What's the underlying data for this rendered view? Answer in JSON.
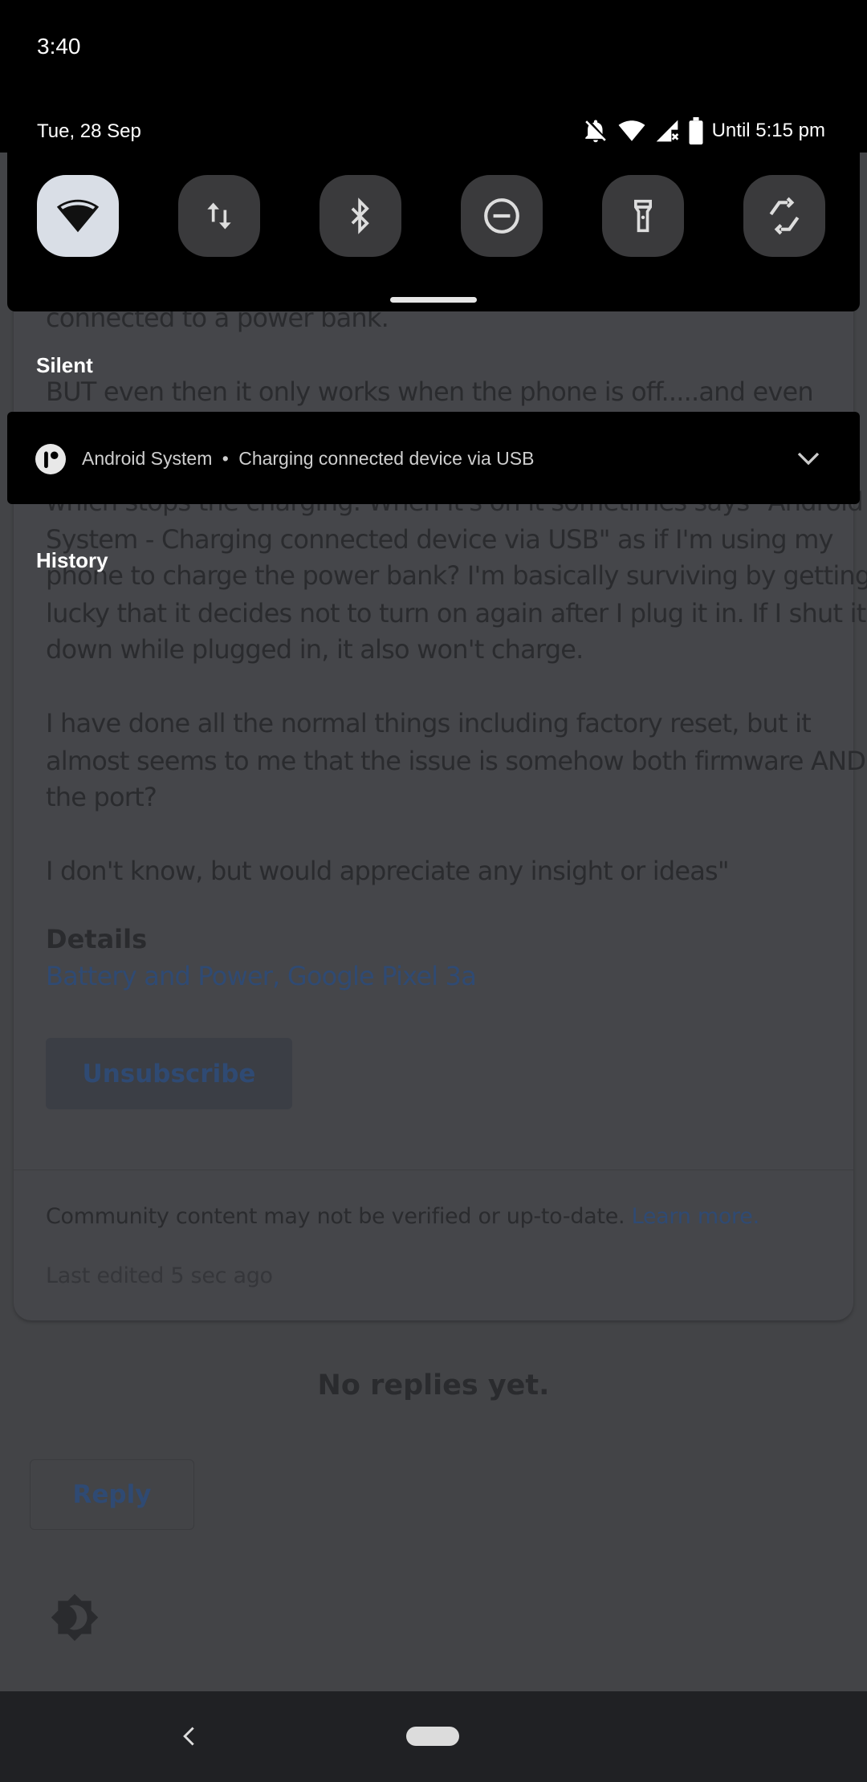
{
  "status_bar": {
    "time": "3:40",
    "date": "Tue, 28 Sep",
    "battery_text": "Until 5:15 pm",
    "icons": [
      "dnd-bell-off-icon",
      "wifi-icon",
      "signal-no-sim-icon",
      "battery-icon"
    ]
  },
  "quick_tiles": [
    {
      "name": "wifi",
      "icon": "wifi-icon",
      "active": true
    },
    {
      "name": "mobile-data",
      "icon": "data-arrows-icon",
      "active": false
    },
    {
      "name": "bluetooth",
      "icon": "bluetooth-icon",
      "active": false
    },
    {
      "name": "do-not-disturb",
      "icon": "dnd-icon",
      "active": false
    },
    {
      "name": "flashlight",
      "icon": "flashlight-icon",
      "active": false
    },
    {
      "name": "auto-rotate",
      "icon": "rotate-icon",
      "active": false
    }
  ],
  "sections": {
    "silent": "Silent",
    "history": "History"
  },
  "notification": {
    "app": "Android System",
    "separator": "•",
    "text": "Charging connected device via USB"
  },
  "page": {
    "lines": [
      "connected to a power bank.",
      "BUT even then it only works when the phone is off.....and even",
      "which stops the charging. When it's on it sometimes says \"Android",
      "System - Charging connected device via USB\" as if I'm using my",
      "phone to charge the power bank? I'm basically surviving by getting",
      "lucky that it decides not to turn on again after I plug it in. If I shut it",
      "down while plugged in, it also won't charge.",
      "I have done all the normal things including factory reset, but it",
      "almost seems to me that the issue is somehow both firmware AND",
      "the port?",
      "I don't know, but would appreciate any insight or ideas\""
    ],
    "details_label": "Details",
    "details_link": "Battery and Power, Google Pixel 3a",
    "unsubscribe": "Unsubscribe",
    "disclaimer": "Community content may not be verified or up-to-date.",
    "learn_more": "Learn more.",
    "last_edited": "Last edited 5 sec ago",
    "no_replies": "No replies yet.",
    "reply": "Reply"
  },
  "colors": {
    "link": "#2f4a73",
    "tile_active": "#d9dee6",
    "tile_inactive": "#3a3a3c",
    "nav_bar": "#202124"
  }
}
